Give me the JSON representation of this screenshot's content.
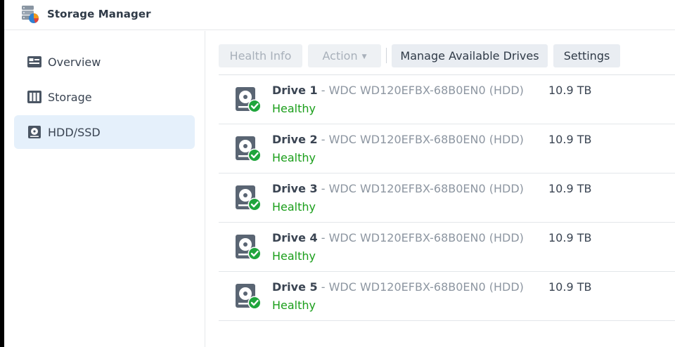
{
  "app": {
    "title": "Storage Manager"
  },
  "sidebar": {
    "items": [
      {
        "label": "Overview",
        "icon": "overview-icon",
        "active": false
      },
      {
        "label": "Storage",
        "icon": "storage-icon",
        "active": false
      },
      {
        "label": "HDD/SSD",
        "icon": "hdd-icon",
        "active": true
      }
    ]
  },
  "toolbar": {
    "health_info_label": "Health Info",
    "action_label": "Action",
    "manage_drives_label": "Manage Available Drives",
    "settings_label": "Settings"
  },
  "drives": [
    {
      "name": "Drive 1",
      "model": " - WDC WD120EFBX-68B0EN0 (HDD)",
      "status": "Healthy",
      "size": "10.9 TB"
    },
    {
      "name": "Drive 2",
      "model": " - WDC WD120EFBX-68B0EN0 (HDD)",
      "status": "Healthy",
      "size": "10.9 TB"
    },
    {
      "name": "Drive 3",
      "model": " - WDC WD120EFBX-68B0EN0 (HDD)",
      "status": "Healthy",
      "size": "10.9 TB"
    },
    {
      "name": "Drive 4",
      "model": " - WDC WD120EFBX-68B0EN0 (HDD)",
      "status": "Healthy",
      "size": "10.9 TB"
    },
    {
      "name": "Drive 5",
      "model": " - WDC WD120EFBX-68B0EN0 (HDD)",
      "status": "Healthy",
      "size": "10.9 TB"
    }
  ],
  "colors": {
    "healthy": "#1a9e1a",
    "active_nav": "#e5f0fb",
    "button_bg": "#e9edf2"
  }
}
